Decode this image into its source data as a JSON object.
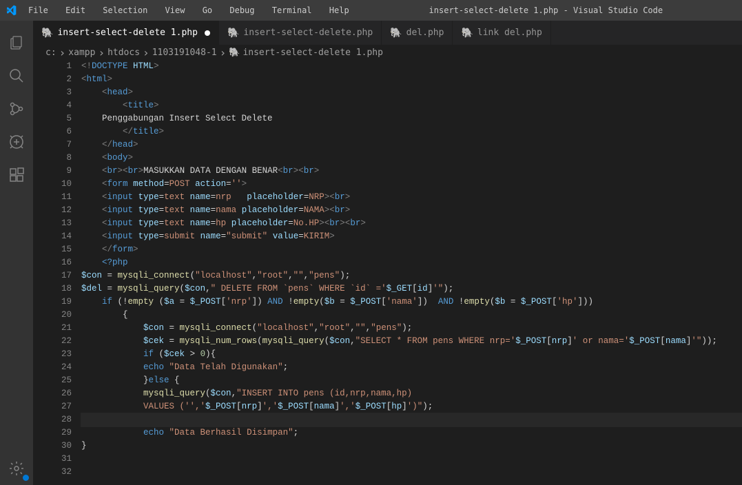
{
  "titlebar": {
    "menu": [
      "File",
      "Edit",
      "Selection",
      "View",
      "Go",
      "Debug",
      "Terminal",
      "Help"
    ],
    "title": "insert-select-delete 1.php - Visual Studio Code"
  },
  "tabs": [
    {
      "label": "insert-select-delete 1.php",
      "active": true,
      "dirty": true
    },
    {
      "label": "insert-select-delete.php",
      "active": false,
      "dirty": false
    },
    {
      "label": "del.php",
      "active": false,
      "dirty": false
    },
    {
      "label": "link del.php",
      "active": false,
      "dirty": false
    }
  ],
  "breadcrumb": {
    "p1": "c:",
    "p2": "xampp",
    "p3": "htdocs",
    "p4": "1103191048-1",
    "p5": "insert-select-delete 1.php"
  },
  "lines": [
    "1",
    "2",
    "3",
    "4",
    "5",
    "6",
    "7",
    "8",
    "9",
    "10",
    "11",
    "12",
    "13",
    "14",
    "15",
    "16",
    "17",
    "18",
    "19",
    "20",
    "21",
    "22",
    "23",
    "24",
    "25",
    "26",
    "27",
    "28",
    "29",
    "30",
    "31",
    "32"
  ]
}
